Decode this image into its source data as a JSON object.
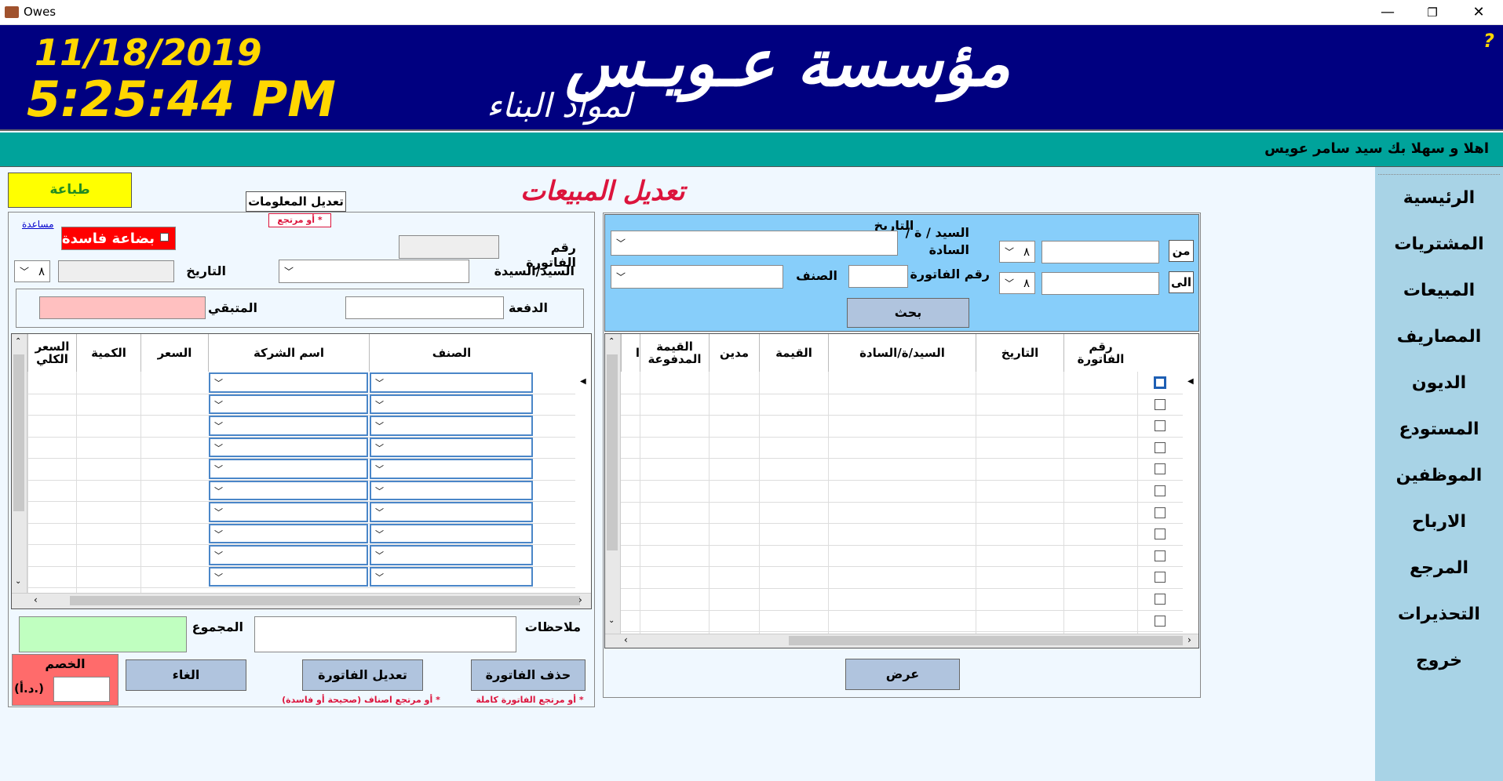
{
  "window": {
    "title": "Owes",
    "minimize": "—",
    "maximize": "❐",
    "close": "✕"
  },
  "header": {
    "date": "11/18/2019",
    "time": "5:25:44 PM",
    "company_name": "مؤسسة عـويـس",
    "company_sub": "لمواد البناء",
    "help": "?"
  },
  "welcome": "اهلا و سهلا بك سيد سامر عويس",
  "sidebar": {
    "items": [
      "الرئيسية",
      "المشتريات",
      "المبيعات",
      "المصاريف",
      "الديون",
      "المستودع",
      "الموظفين",
      "الارباح",
      "المرجع",
      "التحذيرات",
      "خروج"
    ]
  },
  "page_title": "تعديل المبيعات",
  "left_panel": {
    "print_button": "طباعة",
    "edit_info_label": "تعديل المعلومات",
    "edit_info_note": "* أو مرتجع",
    "help_link": "مساعدة",
    "damaged_goods": "بضاعة فاسدة",
    "invoice_no_label": "رقم الفاتورة",
    "customer_label": "السيد/السيدة",
    "date_label": "التاريخ",
    "date_select_value": "٨",
    "payment_label": "الدفعة",
    "remaining_label": "المتبقي",
    "grid_columns": [
      "الصنف",
      "اسم الشركة",
      "السعر",
      "الكمية",
      "السعر الكلي"
    ],
    "total_label": "المجموع",
    "notes_label": "ملاحظات",
    "discount_label": "الخصم",
    "discount_unit": "(د.أ.)",
    "cancel_button": "الغاء",
    "edit_invoice_button": "تعديل الفاتورة",
    "edit_invoice_note": "* أو مرتجع اصناف (صحيحة أو فاسدة)",
    "delete_invoice_button": "حذف الفاتورة",
    "delete_invoice_note": "* أو مرتجع الفاتورة كاملة"
  },
  "right_panel": {
    "date_label": "التاريخ",
    "from_button": "من",
    "to_button": "الى",
    "from_select": "٨",
    "to_select": "٨",
    "customer_label": "السيد / ة / السادة",
    "invoice_no_label": "رقم الفاتورة",
    "item_label": "الصنف",
    "search_button": "بحث",
    "grid_columns": [
      "رقم الفاتورة",
      "التاريخ",
      "السيد/ة/السادة",
      "القيمة",
      "مدين",
      "القيمة المدفوعة",
      "ا"
    ],
    "show_button": "عرض"
  }
}
